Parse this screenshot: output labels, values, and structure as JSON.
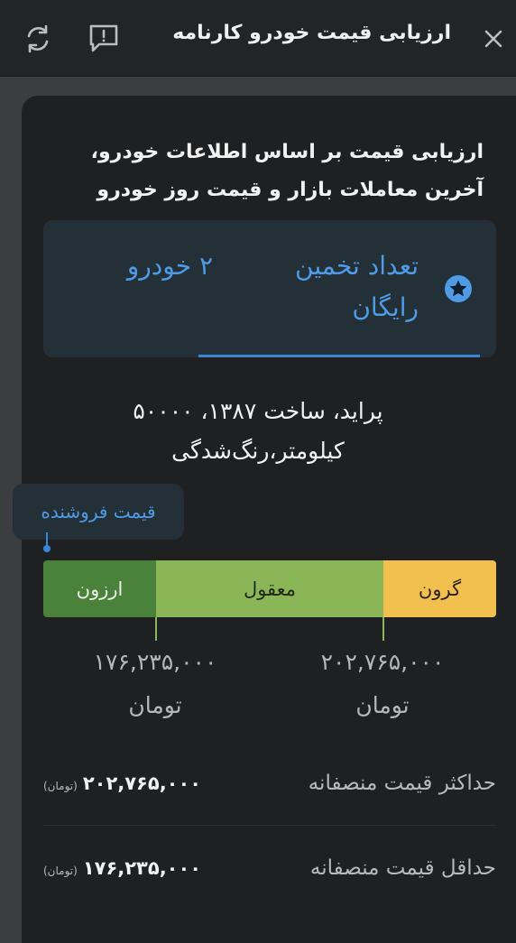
{
  "header": {
    "title": "ارزیابی قیمت خودرو کارنامه"
  },
  "intro": {
    "text": "ارزیابی قیمت بر اساس اطلاعات خودرو، آخرین معاملات بازار و قیمت روز خودرو"
  },
  "promo": {
    "label": "تعداد تخمین رایگان",
    "count": "۲ خودرو"
  },
  "car": {
    "description": "پراید، ساخت ۱۳۸۷، ۵۰۰۰۰ کیلومتر،رنگ‌شدگی"
  },
  "seller_price": {
    "label": "قیمت فروشنده",
    "position_fraction": 0.01
  },
  "price_bar": {
    "segments": [
      {
        "label": "ارزون",
        "color": "#4a813b"
      },
      {
        "label": "معقول",
        "color": "#8bb658"
      },
      {
        "label": "گرون",
        "color": "#f2c04f"
      }
    ],
    "low": {
      "value": "۱۷۶,۲۳۵,۰۰۰",
      "unit": "تومان"
    },
    "high": {
      "value": "۲۰۲,۷۶۵,۰۰۰",
      "unit": "تومان"
    }
  },
  "summary": {
    "max": {
      "label": "حداکثر قیمت منصفانه",
      "value": "۲۰۲,۷۶۵,۰۰۰",
      "unit": "(تومان)"
    },
    "min": {
      "label": "حداقل قیمت منصفانه",
      "value": "۱۷۶,۲۳۵,۰۰۰",
      "unit": "(تومان)"
    }
  },
  "colors": {
    "accent": "#4f9be6",
    "card": "#1f2022",
    "header": "#232427"
  }
}
